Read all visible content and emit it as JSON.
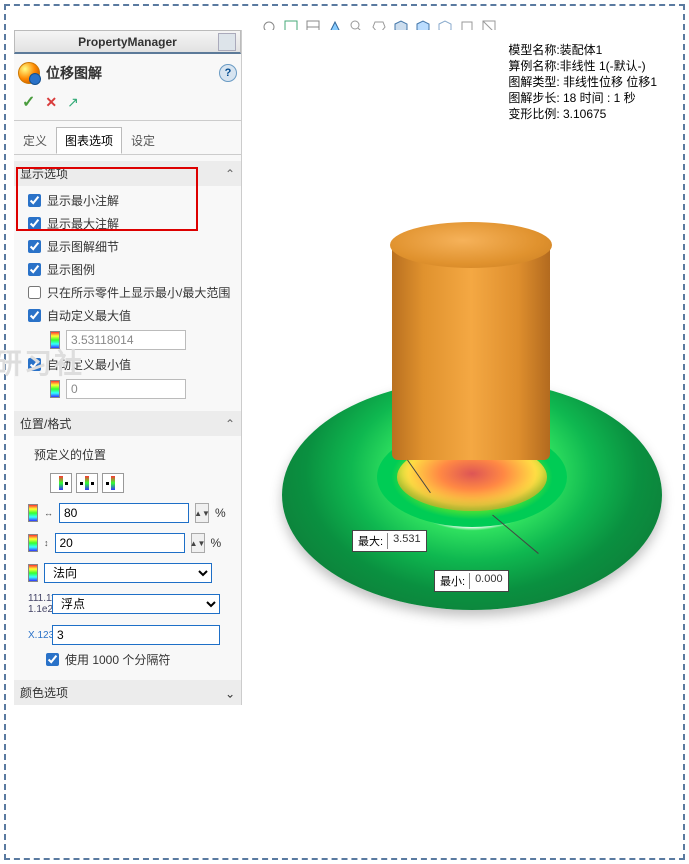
{
  "header": {
    "property_manager": "PropertyManager",
    "title": "位移图解"
  },
  "tabs": {
    "def": "定义",
    "chart_opts": "图表选项",
    "settings": "设定"
  },
  "display_options": {
    "heading": "显示选项",
    "show_min_annot": "显示最小注解",
    "show_max_annot": "显示最大注解",
    "show_plot_detail": "显示图解细节",
    "show_legend": "显示图例",
    "only_selected": "只在所示零件上显示最小/最大范围",
    "auto_max": "自动定义最大值",
    "max_val": "3.53118014",
    "auto_min": "自动定义最小值",
    "min_val": "0"
  },
  "position_format": {
    "heading": "位置/格式",
    "predef": "预定义的位置",
    "width_pct": "80",
    "height_pct": "20",
    "pct": "%",
    "direction": "法向",
    "number_format": "浮点",
    "decimals": "3",
    "use_separator": "使用 1000 个分隔符"
  },
  "color_options": "颜色选项",
  "info": {
    "l1": "模型名称:装配体1",
    "l2": "算例名称:非线性 1(-默认-)",
    "l3": "图解类型: 非线性位移 位移1",
    "l4": "图解步长: 18   时间 :  1 秒",
    "l5": "变形比例: 3.10675"
  },
  "callouts": {
    "max_label": "最大:",
    "max_val": "3.531",
    "min_label": "最小:",
    "min_val": "0.000"
  },
  "icons": {
    "help": "?",
    "caret": "⌃"
  }
}
